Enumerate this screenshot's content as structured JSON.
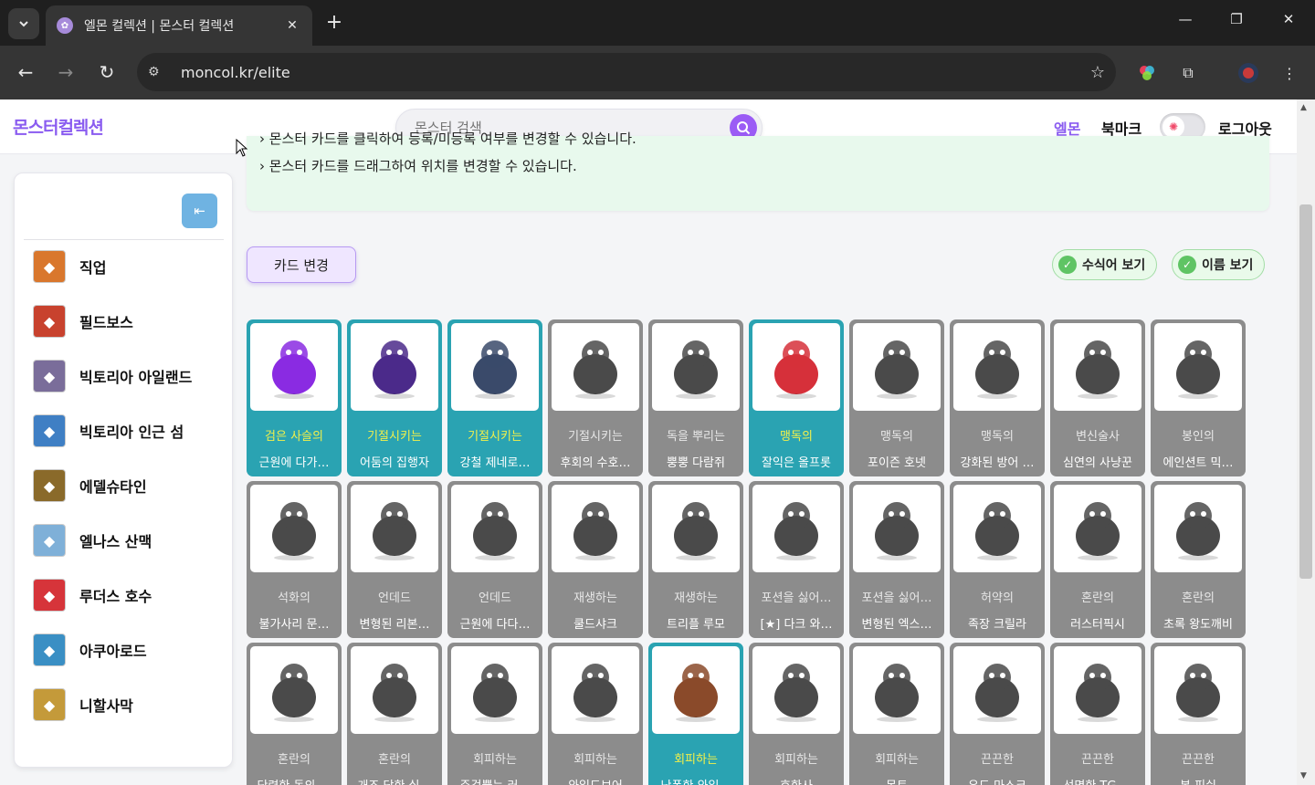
{
  "browser": {
    "tab_title": "엘몬 컬렉션 | 몬스터 컬렉션",
    "url": "moncol.kr/elite",
    "tab_close": "✕",
    "new_tab": "+"
  },
  "site": {
    "logo": "몬스터컬렉션",
    "search_placeholder": "몬스터 검색",
    "nav": {
      "elmon": "엘몬",
      "bookmark": "북마크",
      "logout": "로그아웃"
    }
  },
  "sidebar": {
    "items": [
      {
        "label": "직업",
        "icon": "mushroom-icon",
        "color": "#d9772d"
      },
      {
        "label": "필드보스",
        "icon": "fieldboss-icon",
        "color": "#c8422e"
      },
      {
        "label": "빅토리아 아일랜드",
        "icon": "shield-icon",
        "color": "#7a6d9a"
      },
      {
        "label": "빅토리아 인근 섬",
        "icon": "island-icon",
        "color": "#3f7fc4"
      },
      {
        "label": "에델슈타인",
        "icon": "gear-emblem-icon",
        "color": "#8a6a2a"
      },
      {
        "label": "엘나스 산맥",
        "icon": "snowflake-icon",
        "color": "#7fb0d8"
      },
      {
        "label": "루더스 호수",
        "icon": "toy-castle-icon",
        "color": "#d6343a"
      },
      {
        "label": "아쿠아로드",
        "icon": "globe-icon",
        "color": "#3a8fc4"
      },
      {
        "label": "니할사막",
        "icon": "desert-icon",
        "color": "#c49a3a"
      }
    ]
  },
  "notice": {
    "line1": "› 몬스터 카드를 클릭하여 등록/미등록 여부를 변경할 수 있습니다.",
    "line2": "› 몬스터 카드를 드래그하여 위치를 변경할 수 있습니다."
  },
  "controls": {
    "card_change": "카드 변경",
    "modifier_view": "수식어 보기",
    "name_view": "이름 보기"
  },
  "cards": [
    {
      "tag": "검은 사슬의",
      "name": "근원에 다가…",
      "registered": true,
      "hue": "#8a2be2"
    },
    {
      "tag": "기절시키는",
      "name": "어둠의 집행자",
      "registered": true,
      "hue": "#4b2a8a"
    },
    {
      "tag": "기절시키는",
      "name": "강철 제네로…",
      "registered": true,
      "hue": "#3a4a6a"
    },
    {
      "tag": "기절시키는",
      "name": "후회의 수호…",
      "registered": false,
      "hue": "#555"
    },
    {
      "tag": "독을 뿌리는",
      "name": "뿡뿡 다람쥐",
      "registered": false,
      "hue": "#444"
    },
    {
      "tag": "맹독의",
      "name": "잘익은 올프롯",
      "registered": true,
      "hue": "#d6303a"
    },
    {
      "tag": "맹독의",
      "name": "포이즌 호넷",
      "registered": false,
      "hue": "#444"
    },
    {
      "tag": "맹독의",
      "name": "강화된 방어 …",
      "registered": false,
      "hue": "#444"
    },
    {
      "tag": "변신술사",
      "name": "심연의 사냥꾼",
      "registered": false,
      "hue": "#333"
    },
    {
      "tag": "봉인의",
      "name": "에인션트 믹…",
      "registered": false,
      "hue": "#555"
    },
    {
      "tag": "석화의",
      "name": "불가사리 문…",
      "registered": false,
      "hue": "#666"
    },
    {
      "tag": "언데드",
      "name": "변형된 리본…",
      "registered": false,
      "hue": "#666"
    },
    {
      "tag": "언데드",
      "name": "근원에 다다…",
      "registered": false,
      "hue": "#333"
    },
    {
      "tag": "재생하는",
      "name": "쿨드샤크",
      "registered": false,
      "hue": "#777"
    },
    {
      "tag": "재생하는",
      "name": "트리플 루모",
      "registered": false,
      "hue": "#333"
    },
    {
      "tag": "포션을 싫어…",
      "name": "[★] 다크 와…",
      "registered": false,
      "hue": "#333"
    },
    {
      "tag": "포션을 싫어…",
      "name": "변형된 엑스…",
      "registered": false,
      "hue": "#444"
    },
    {
      "tag": "허약의",
      "name": "족장 크릴라",
      "registered": false,
      "hue": "#333"
    },
    {
      "tag": "혼란의",
      "name": "러스터픽시",
      "registered": false,
      "hue": "#777"
    },
    {
      "tag": "혼란의",
      "name": "초록 왕도깨비",
      "registered": false,
      "hue": "#555"
    },
    {
      "tag": "혼란의",
      "name": "단련한 동의 …",
      "registered": false,
      "hue": "#555"
    },
    {
      "tag": "혼란의",
      "name": "개조 당한 실…",
      "registered": false,
      "hue": "#333"
    },
    {
      "tag": "회피하는",
      "name": "주걱뿔는 러…",
      "registered": false,
      "hue": "#666"
    },
    {
      "tag": "회피하는",
      "name": "와일드보어",
      "registered": false,
      "hue": "#333"
    },
    {
      "tag": "회피하는",
      "name": "난폭한 와일…",
      "registered": true,
      "hue": "#8a4a2a"
    },
    {
      "tag": "회피하는",
      "name": "호한사",
      "registered": false,
      "hue": "#444"
    },
    {
      "tag": "회피하는",
      "name": "몬트",
      "registered": false,
      "hue": "#333"
    },
    {
      "tag": "끈끈한",
      "name": "우드 마스크",
      "registered": false,
      "hue": "#444"
    },
    {
      "tag": "끈끈한",
      "name": "선명한 TG …",
      "registered": false,
      "hue": "#333"
    },
    {
      "tag": "끈끈한",
      "name": "본 피쉬",
      "registered": false,
      "hue": "#666"
    }
  ]
}
